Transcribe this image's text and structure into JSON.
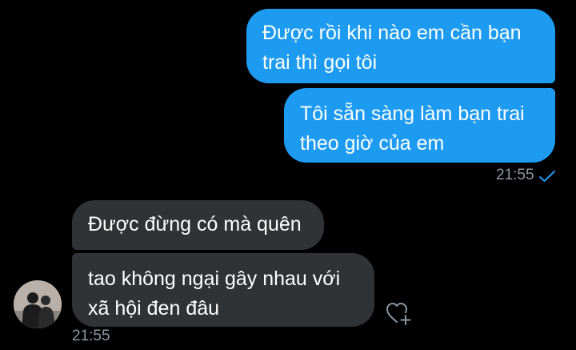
{
  "messages": {
    "sent": [
      {
        "text": "Được rồi khi nào em cần bạn\ntrai thì gọi tôi"
      },
      {
        "text": "Tôi sẵn sàng làm bạn trai\ntheo giờ của em"
      }
    ],
    "sent_time": "21:55",
    "received": [
      {
        "text": "Được đừng có mà quên"
      },
      {
        "text": "tao không ngại gây nhau với\nxã hội đen đâu"
      }
    ],
    "received_time": "21:55"
  },
  "colors": {
    "background": "#000000",
    "sent_bubble": "#1d9bf0",
    "received_bubble": "#2f3336",
    "timestamp": "#8b98a5",
    "read_check": "#1d9bf0"
  },
  "icons": {
    "read_receipt": "check-icon",
    "reaction": "heart-plus-icon",
    "sender_avatar": "avatar"
  }
}
